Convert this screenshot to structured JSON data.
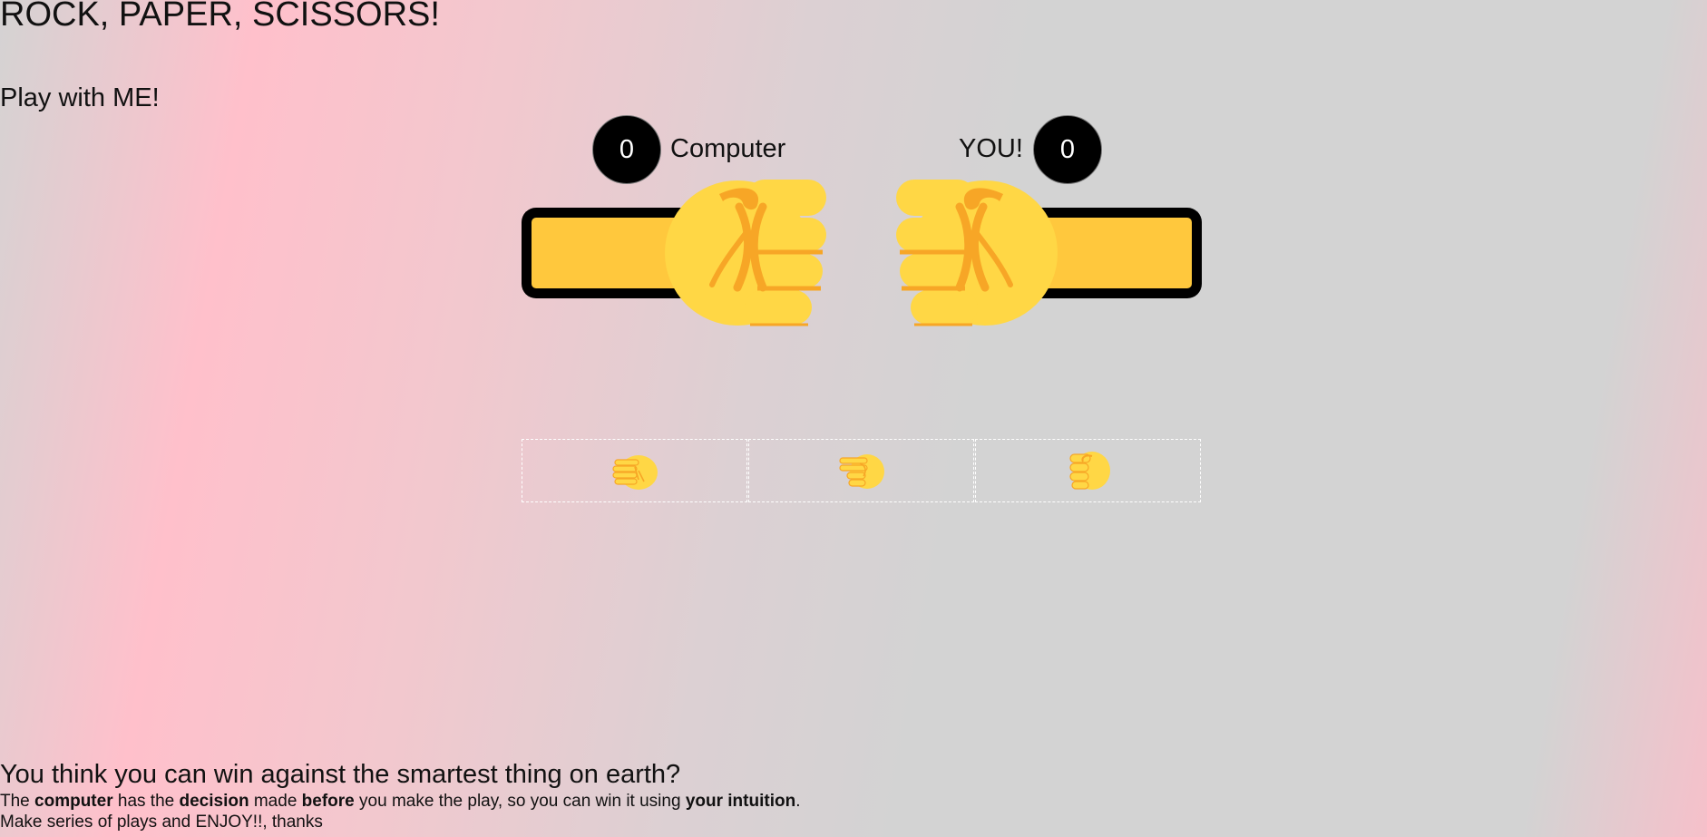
{
  "header": {
    "title": "ROCK, PAPER, SCISSORS!",
    "subtitle": "Play with ME!"
  },
  "scoreboard": {
    "computer_score": "0",
    "computer_label": "Computer",
    "player_label": "YOU!",
    "player_score": "0"
  },
  "arena": {
    "computer_hand": "fist-icon",
    "player_hand": "fist-icon",
    "bar_color": "#ffc83d",
    "fist_color": "#ffd745",
    "fist_shadow_color": "#f7a626"
  },
  "choices": [
    {
      "icon": "paper-hand-icon"
    },
    {
      "icon": "scissors-hand-icon"
    },
    {
      "icon": "rock-hand-icon"
    }
  ],
  "footer": {
    "heading": "You think you can win against the smartest thing on earth?",
    "line1": {
      "p1": "The ",
      "b1": "computer",
      "p2": " has the ",
      "b2": "decision",
      "p3": " made ",
      "b3": "before",
      "p4": " you make the play, so you can win it using ",
      "b4": "your intuition",
      "p5": "."
    },
    "line2": "Make series of plays and ENJOY!!, thanks"
  }
}
